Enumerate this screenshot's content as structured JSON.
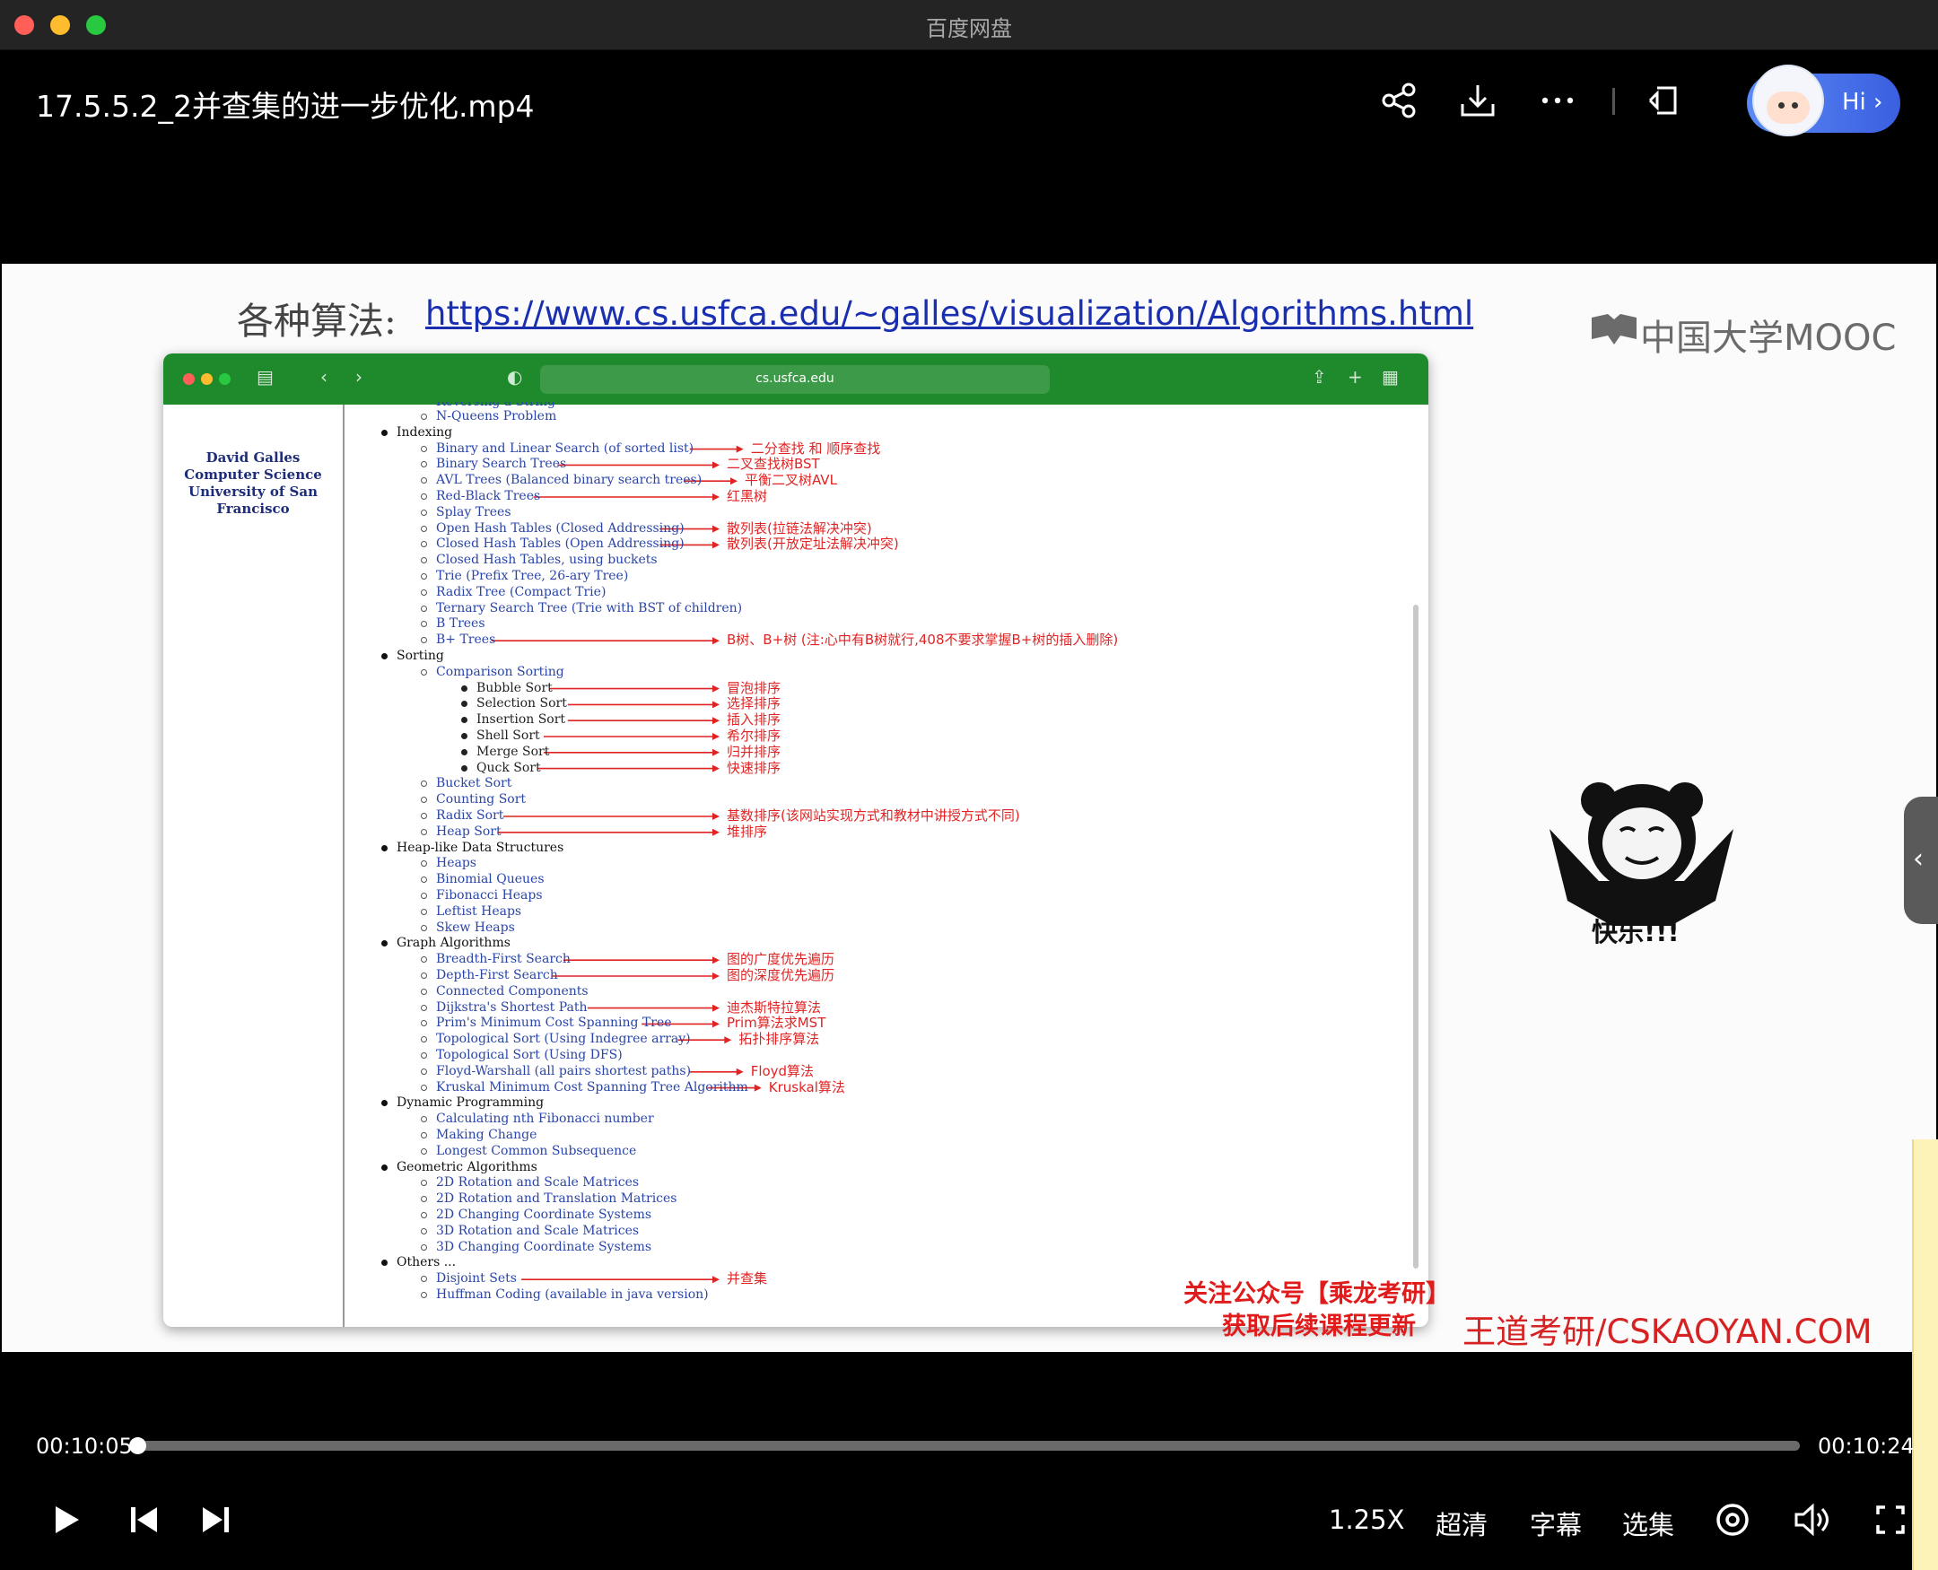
{
  "window": {
    "title": "百度网盘"
  },
  "header": {
    "file_title": "17.5.5.2_2并查集的进一步优化.mp4",
    "icons": [
      "share-icon",
      "download-icon",
      "more-icon",
      "pip-icon"
    ],
    "assistant": {
      "label": "Hi ›"
    }
  },
  "slide": {
    "heading": "各种算法:",
    "link": "https://www.cs.usfca.edu/~galles/visualization/Algorithms.html",
    "mooc_logo": "中国大学MOOC",
    "promo_line1": "关注公众号【乘龙考研】",
    "promo_line2": "获取后续课程更新",
    "brand": "王道考研/CSKAOYAN.COM",
    "meme_caption": "快乐!!!",
    "browser": {
      "url": "cs.usfca.edu",
      "author": "David Galles Computer Science University of San Francisco",
      "top_cut_item": "Reversing a String",
      "items": [
        {
          "lvl": "sub",
          "text": "N-Queens Problem"
        },
        {
          "lvl": "cat",
          "text": "Indexing"
        },
        {
          "lvl": "sub",
          "text": "Binary and Linear Search (of sorted list)",
          "ann": "二分查找 和 顺序查找"
        },
        {
          "lvl": "sub",
          "text": "Binary Search Trees",
          "ann": "二叉查找树BST"
        },
        {
          "lvl": "sub",
          "text": "AVL Trees (Balanced binary search trees)",
          "ann": "平衡二叉树AVL"
        },
        {
          "lvl": "sub",
          "text": "Red-Black Trees",
          "ann": "红黑树"
        },
        {
          "lvl": "sub",
          "text": "Splay Trees"
        },
        {
          "lvl": "sub",
          "text": "Open Hash Tables (Closed Addressing)",
          "ann": "散列表(拉链法解决冲突)"
        },
        {
          "lvl": "sub",
          "text": "Closed Hash Tables (Open Addressing)",
          "ann": "散列表(开放定址法解决冲突)"
        },
        {
          "lvl": "sub",
          "text": "Closed Hash Tables, using buckets"
        },
        {
          "lvl": "sub",
          "text": "Trie (Prefix Tree, 26-ary Tree)"
        },
        {
          "lvl": "sub",
          "text": "Radix Tree (Compact Trie)"
        },
        {
          "lvl": "sub",
          "text": "Ternary Search Tree (Trie with BST of children)"
        },
        {
          "lvl": "sub",
          "text": "B Trees"
        },
        {
          "lvl": "sub",
          "text": "B+ Trees",
          "ann": "B树、B+树 (注:心中有B树就行,408不要求掌握B+树的插入删除)"
        },
        {
          "lvl": "cat",
          "text": "Sorting"
        },
        {
          "lvl": "sub",
          "text": "Comparison Sorting"
        },
        {
          "lvl": "l3",
          "text": "Bubble Sort",
          "ann": "冒泡排序"
        },
        {
          "lvl": "l3",
          "text": "Selection Sort",
          "ann": "选择排序"
        },
        {
          "lvl": "l3",
          "text": "Insertion Sort",
          "ann": "插入排序"
        },
        {
          "lvl": "l3",
          "text": "Shell Sort",
          "ann": "希尔排序"
        },
        {
          "lvl": "l3",
          "text": "Merge Sort",
          "ann": "归并排序"
        },
        {
          "lvl": "l3",
          "text": "Quck Sort",
          "ann": "快速排序"
        },
        {
          "lvl": "sub",
          "text": "Bucket Sort"
        },
        {
          "lvl": "sub",
          "text": "Counting Sort"
        },
        {
          "lvl": "sub",
          "text": "Radix Sort",
          "ann": "基数排序(该网站实现方式和教材中讲授方式不同)"
        },
        {
          "lvl": "sub",
          "text": "Heap Sort",
          "ann": "堆排序"
        },
        {
          "lvl": "cat",
          "text": "Heap-like Data Structures"
        },
        {
          "lvl": "sub",
          "text": "Heaps"
        },
        {
          "lvl": "sub",
          "text": "Binomial Queues"
        },
        {
          "lvl": "sub",
          "text": "Fibonacci Heaps"
        },
        {
          "lvl": "sub",
          "text": "Leftist Heaps"
        },
        {
          "lvl": "sub",
          "text": "Skew Heaps"
        },
        {
          "lvl": "cat",
          "text": "Graph Algorithms"
        },
        {
          "lvl": "sub",
          "text": "Breadth-First Search",
          "ann": "图的广度优先遍历"
        },
        {
          "lvl": "sub",
          "text": "Depth-First Search",
          "ann": "图的深度优先遍历"
        },
        {
          "lvl": "sub",
          "text": "Connected Components"
        },
        {
          "lvl": "sub",
          "text": "Dijkstra's Shortest Path",
          "ann": "迪杰斯特拉算法"
        },
        {
          "lvl": "sub",
          "text": "Prim's Minimum Cost Spanning Tree",
          "ann": "Prim算法求MST"
        },
        {
          "lvl": "sub",
          "text": "Topological Sort (Using Indegree array)",
          "ann": "拓扑排序算法"
        },
        {
          "lvl": "sub",
          "text": "Topological Sort (Using DFS)"
        },
        {
          "lvl": "sub",
          "text": "Floyd-Warshall (all pairs shortest paths)",
          "ann": "Floyd算法"
        },
        {
          "lvl": "sub",
          "text": "Kruskal Minimum Cost Spanning Tree Algorithm",
          "ann": "Kruskal算法"
        },
        {
          "lvl": "cat",
          "text": "Dynamic Programming"
        },
        {
          "lvl": "sub",
          "text": "Calculating nth Fibonacci number"
        },
        {
          "lvl": "sub",
          "text": "Making Change"
        },
        {
          "lvl": "sub",
          "text": "Longest Common Subsequence"
        },
        {
          "lvl": "cat",
          "text": "Geometric Algorithms"
        },
        {
          "lvl": "sub",
          "text": "2D Rotation and Scale Matrices"
        },
        {
          "lvl": "sub",
          "text": "2D Rotation and Translation Matrices"
        },
        {
          "lvl": "sub",
          "text": "2D Changing Coordinate Systems"
        },
        {
          "lvl": "sub",
          "text": "3D Rotation and Scale Matrices"
        },
        {
          "lvl": "sub",
          "text": "3D Changing Coordinate Systems"
        },
        {
          "lvl": "cat",
          "text": "Others ..."
        },
        {
          "lvl": "sub",
          "text": "Disjoint Sets",
          "ann": "并查集"
        },
        {
          "lvl": "sub",
          "text": "Huffman Coding (available in java version)"
        }
      ]
    }
  },
  "player": {
    "current_time": "00:10:05",
    "total_time": "00:10:24",
    "progress": 0.001,
    "speed": "1.25X",
    "quality": "超清",
    "subtitles": "字幕",
    "episodes": "选集"
  }
}
